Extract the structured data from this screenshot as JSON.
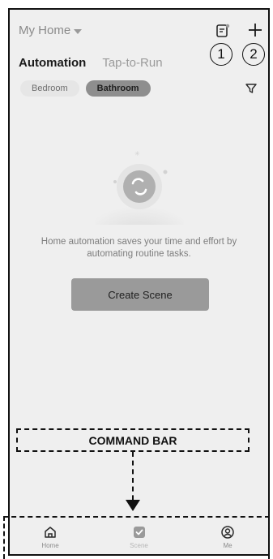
{
  "header": {
    "home_title": "My Home",
    "tabs": [
      {
        "label": "Automation",
        "active": true
      },
      {
        "label": "Tap-to-Run",
        "active": false
      }
    ],
    "chips": [
      {
        "label": "Bedroom",
        "selected": false
      },
      {
        "label": "Bathroom",
        "selected": true
      }
    ],
    "icons": {
      "caret": "chevron-down-icon",
      "notes": "notes-icon",
      "add": "plus-icon",
      "filter": "filter-icon"
    },
    "annotations": [
      "1",
      "2"
    ]
  },
  "empty_state": {
    "message": "Home automation saves your time and effort by automating routine tasks.",
    "icon": "sync-icon",
    "button_label": "Create Scene"
  },
  "command_bar": {
    "label": "COMMAND BAR"
  },
  "bottom_nav": {
    "items": [
      {
        "label": "Home",
        "icon": "home-icon",
        "active": false
      },
      {
        "label": "Scene",
        "icon": "scene-check-icon",
        "active": true
      },
      {
        "label": "Me",
        "icon": "profile-icon",
        "active": false
      }
    ]
  },
  "colors": {
    "background": "#efefef",
    "button": "#9a9a9a",
    "selected_chip": "#8e8e8e",
    "annotation": "#111111"
  }
}
